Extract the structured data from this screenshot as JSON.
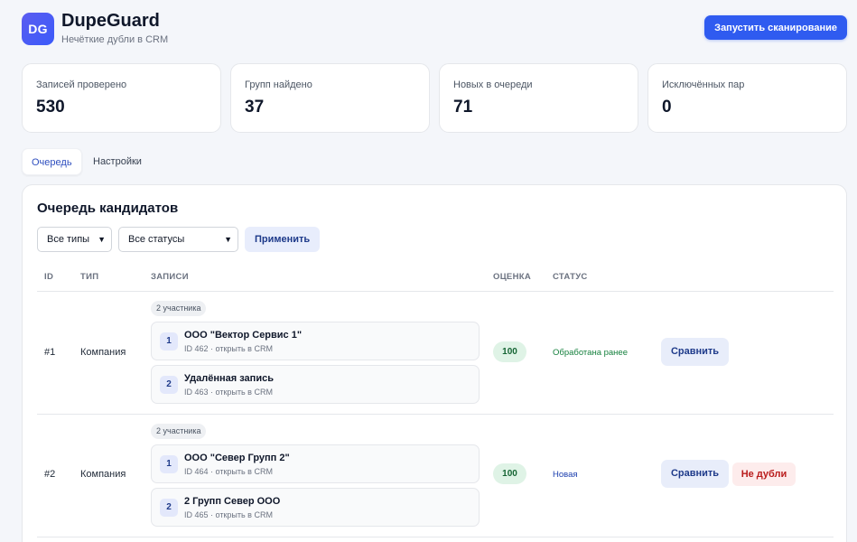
{
  "app": {
    "logo": "DG",
    "title": "DupeGuard",
    "subtitle": "Нечёткие дубли в CRM",
    "scan_button": "Запустить сканирование"
  },
  "stats": [
    {
      "label": "Записей проверено",
      "value": "530"
    },
    {
      "label": "Групп найдено",
      "value": "37"
    },
    {
      "label": "Новых в очереди",
      "value": "71"
    },
    {
      "label": "Исключённых пар",
      "value": "0"
    }
  ],
  "tabs": [
    {
      "label": "Очередь",
      "active": true
    },
    {
      "label": "Настройки",
      "active": false
    }
  ],
  "queue": {
    "title": "Очередь кандидатов",
    "filters": {
      "type_select": "Все типы",
      "status_select": "Все статусы",
      "apply_button": "Применить"
    },
    "columns": {
      "id": "ID",
      "type": "ТИП",
      "records": "ЗАПИСИ",
      "score": "ОЦЕНКА",
      "status": "СТАТУС"
    },
    "rows": [
      {
        "id": "#1",
        "type": "Компания",
        "participants": "2 участника",
        "records": [
          {
            "num": "1",
            "name": "ООО \"Вектор Сервис 1\"",
            "meta": "ID 462 · открыть в CRM"
          },
          {
            "num": "2",
            "name": "Удалённая запись",
            "meta": "ID 463 · открыть в CRM"
          }
        ],
        "score": "100",
        "status": "Обработана ранее",
        "status_color": "#15803d",
        "compare_button": "Сравнить"
      },
      {
        "id": "#2",
        "type": "Компания",
        "participants": "2 участника",
        "records": [
          {
            "num": "1",
            "name": "ООО \"Север Групп 2\"",
            "meta": "ID 464 · открыть в CRM"
          },
          {
            "num": "2",
            "name": "2 Групп Север ООО",
            "meta": "ID 465 · открыть в CRM"
          }
        ],
        "score": "100",
        "status": "Новая",
        "status_color": "#1e40af",
        "compare_button": "Сравнить",
        "not_duplicate_button": "Не дубли"
      }
    ]
  },
  "colors": {
    "accent": "#2f5bf0",
    "background": "#f4f6fa"
  }
}
